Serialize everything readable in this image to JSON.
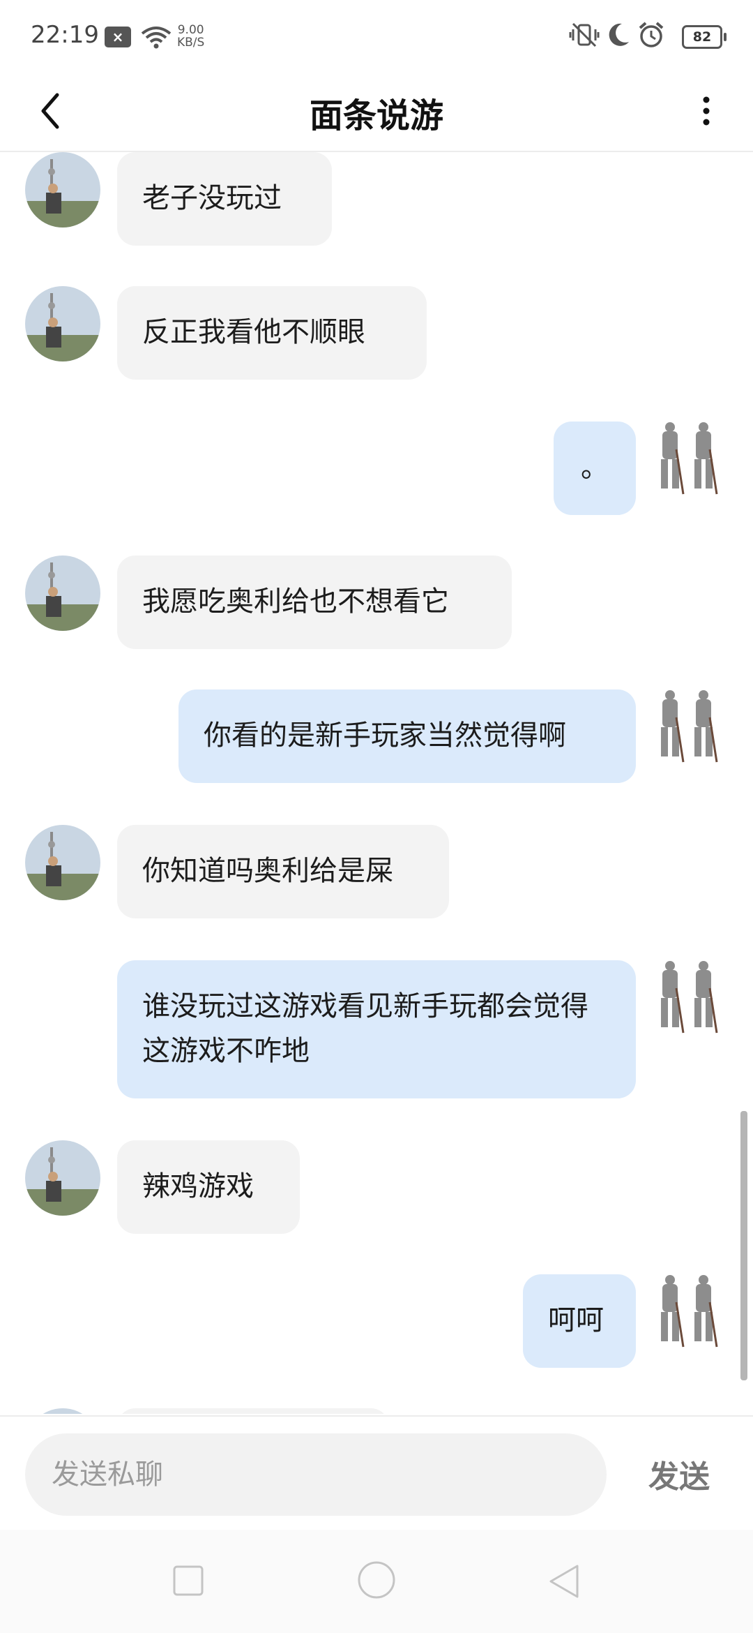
{
  "status_bar": {
    "time": "22:19",
    "notification_badge": "×",
    "net_speed_value": "9.00",
    "net_speed_unit": "KB/S",
    "battery": "82",
    "icons": [
      "close-notification-icon",
      "wifi-icon",
      "vibrate-off-icon",
      "moon-icon",
      "alarm-icon",
      "battery-icon"
    ]
  },
  "header": {
    "title": "面条说游",
    "back_icon": "chevron-left-icon",
    "menu_icon": "more-vertical-icon"
  },
  "messages": [
    {
      "side": "in",
      "text": "老子没玩过"
    },
    {
      "side": "in",
      "text": "反正我看他不顺眼"
    },
    {
      "side": "out",
      "text": "。"
    },
    {
      "side": "in",
      "text": "我愿吃奥利给也不想看它"
    },
    {
      "side": "out",
      "text": "你看的是新手玩家当然觉得啊"
    },
    {
      "side": "in",
      "text": "你知道吗奥利给是屎"
    },
    {
      "side": "out",
      "text": "谁没玩过这游戏看见新手玩都会觉得这游戏不咋地"
    },
    {
      "side": "in",
      "text": "辣鸡游戏"
    },
    {
      "side": "out",
      "text": "呵呵"
    }
  ],
  "composer": {
    "placeholder": "发送私聊",
    "send_label": "发送"
  },
  "nav_bar": {
    "icons": [
      "recents-square-icon",
      "home-circle-icon",
      "back-triangle-icon"
    ]
  },
  "colors": {
    "incoming_bubble": "#f3f3f3",
    "outgoing_bubble": "#dbeafb",
    "background": "#ffffff"
  }
}
